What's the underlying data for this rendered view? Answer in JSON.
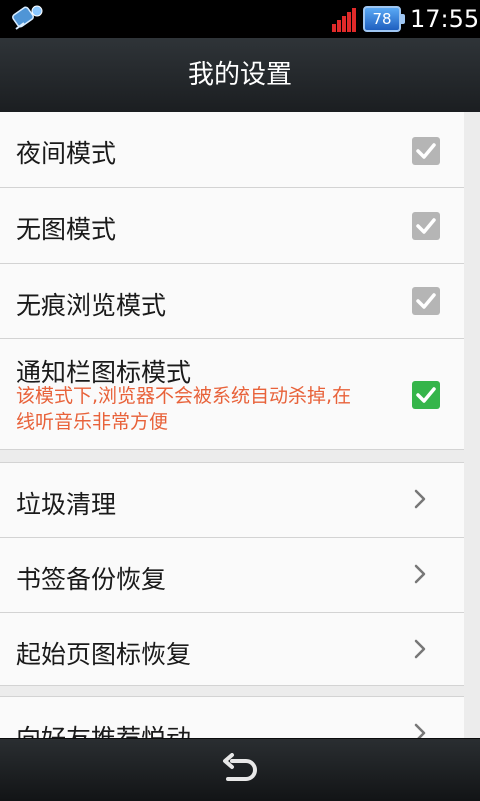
{
  "status_bar": {
    "battery_level": "78",
    "time": "17:55",
    "left_icon": "app-notification-icon",
    "signal_icon": "signal-bars-icon"
  },
  "header": {
    "title": "我的设置"
  },
  "settings": {
    "night_mode": {
      "label": "夜间模式",
      "checked": true
    },
    "no_image_mode": {
      "label": "无图模式",
      "checked": true
    },
    "incognito_mode": {
      "label": "无痕浏览模式",
      "checked": true
    },
    "notification_mode": {
      "label": "通知栏图标模式",
      "description": "该模式下,浏览器不会被系统自动杀掉,在线听音乐非常方便",
      "checked": true
    },
    "garbage_clean": {
      "label": "垃圾清理"
    },
    "bookmark_backup": {
      "label": "书签备份恢复"
    },
    "homepage_icon_restore": {
      "label": "起始页图标恢复"
    },
    "recommend_friends": {
      "label": "向好友推荐悦动"
    }
  },
  "colors": {
    "accent_green": "#35b54a",
    "description_orange": "#e8623a",
    "checkbox_gray": "#b5b5b5"
  },
  "bottom_bar": {
    "back_icon": "back-arrow-icon"
  }
}
